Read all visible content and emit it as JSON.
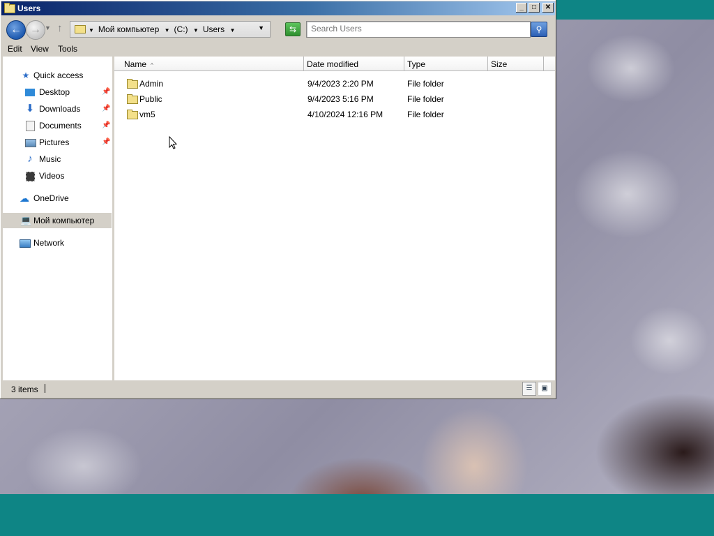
{
  "window": {
    "title": "Users",
    "controls": {
      "minimize": "_",
      "maximize": "□",
      "close": "✕"
    }
  },
  "address_bar": {
    "crumbs": [
      "Мой компьютер",
      "(C:)",
      "Users"
    ],
    "search_placeholder": "Search Users"
  },
  "menu": {
    "items": [
      "Edit",
      "View",
      "Tools"
    ]
  },
  "nav_pane": {
    "quick_access": "Quick access",
    "items": [
      {
        "label": "Desktop",
        "icon": "desktop-icon",
        "pinned": true
      },
      {
        "label": "Downloads",
        "icon": "downloads-icon",
        "pinned": true
      },
      {
        "label": "Documents",
        "icon": "documents-icon",
        "pinned": true
      },
      {
        "label": "Pictures",
        "icon": "pictures-icon",
        "pinned": true
      },
      {
        "label": "Music",
        "icon": "music-icon",
        "pinned": false
      },
      {
        "label": "Videos",
        "icon": "videos-icon",
        "pinned": false
      }
    ],
    "onedrive": "OneDrive",
    "this_pc": "Мой компьютер",
    "network": "Network"
  },
  "file_list": {
    "columns": [
      "Name",
      "Date modified",
      "Type",
      "Size"
    ],
    "sort_indicator": "^",
    "rows": [
      {
        "name": "Admin",
        "date": "9/4/2023 2:20 PM",
        "type": "File folder",
        "size": ""
      },
      {
        "name": "Public",
        "date": "9/4/2023 5:16 PM",
        "type": "File folder",
        "size": ""
      },
      {
        "name": "vm5",
        "date": "4/10/2024 12:16 PM",
        "type": "File folder",
        "size": ""
      }
    ]
  },
  "status_bar": {
    "item_count": "3 items"
  },
  "colors": {
    "desktop_teal": "#0e8585",
    "titlebar_start": "#0a246a",
    "titlebar_end": "#a6caf0"
  }
}
